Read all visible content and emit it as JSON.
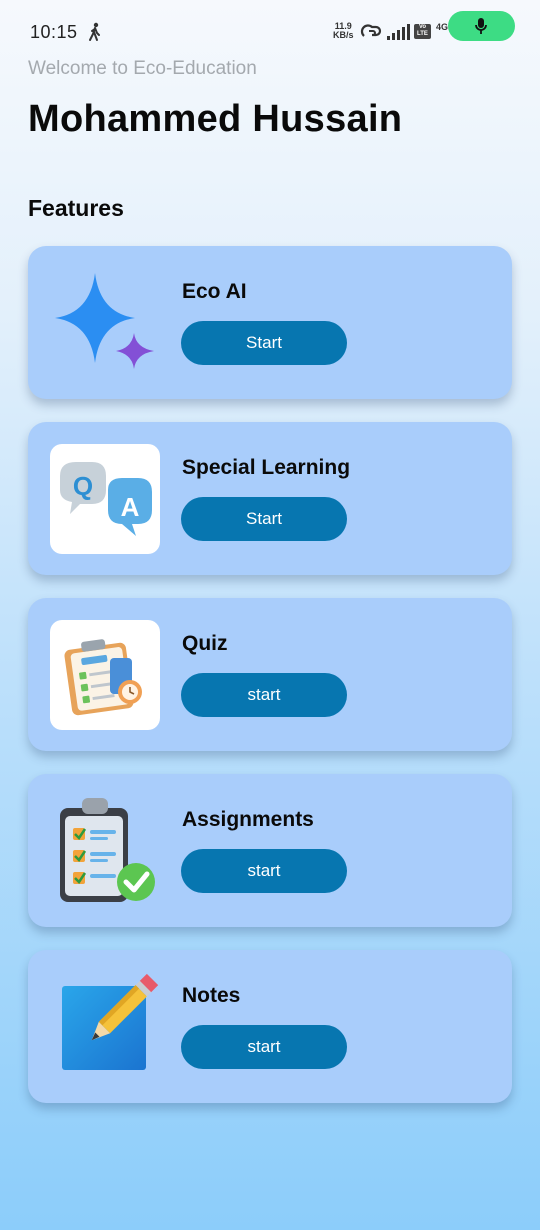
{
  "status_bar": {
    "time": "10:15",
    "net_speed_value": "11.9",
    "net_speed_unit": "KB/s",
    "volte": "Vo LTE",
    "network": "4G"
  },
  "header": {
    "welcome": "Welcome to Eco-Education",
    "user_name": "Mohammed Hussain"
  },
  "features_title": "Features",
  "features": [
    {
      "title": "Eco AI",
      "button": "Start",
      "icon": "sparkle-icon"
    },
    {
      "title": "Special Learning",
      "button": "Start",
      "icon": "qa-bubbles-icon"
    },
    {
      "title": "Quiz",
      "button": "start",
      "icon": "test-clipboard-icon"
    },
    {
      "title": "Assignments",
      "button": "start",
      "icon": "checklist-clipboard-icon"
    },
    {
      "title": "Notes",
      "button": "start",
      "icon": "pencil-note-icon"
    }
  ],
  "colors": {
    "card": "#a9cdfb",
    "button": "#0776b0",
    "mic_pill": "#3ddc84"
  }
}
